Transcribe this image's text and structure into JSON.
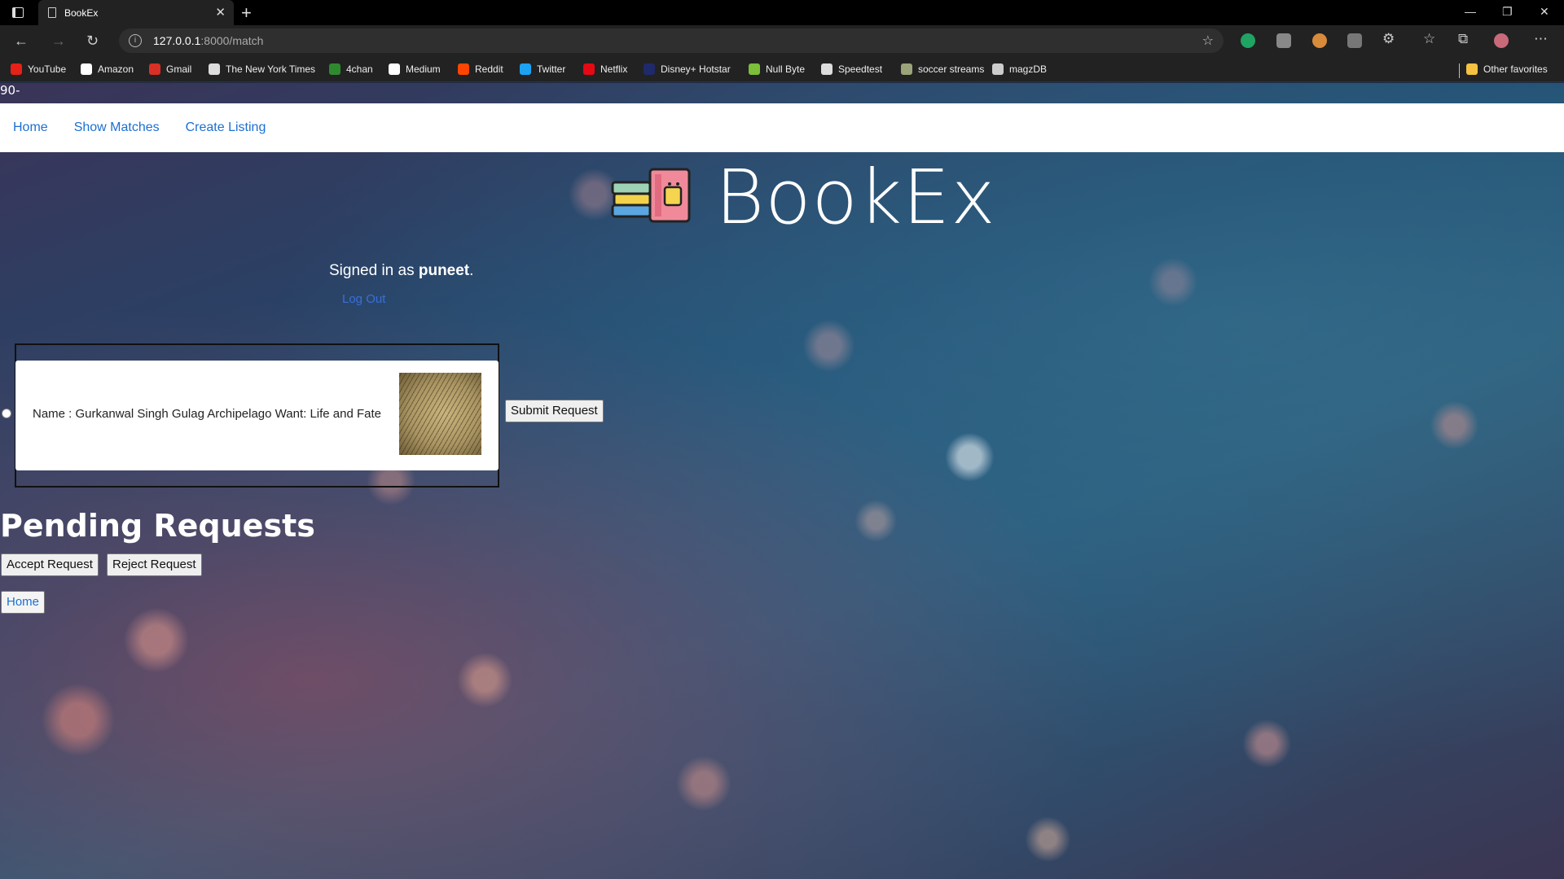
{
  "browser": {
    "tab_title": "BookEx",
    "url_host": "127.0.0.1",
    "url_path": ":8000/match",
    "bookmarks": [
      {
        "label": "YouTube",
        "icon": "youtube-icon",
        "color": "#e62117"
      },
      {
        "label": "Amazon",
        "icon": "amazon-icon",
        "color": "#ffffff"
      },
      {
        "label": "Gmail",
        "icon": "gmail-icon",
        "color": "#d93025"
      },
      {
        "label": "The New York Times",
        "icon": "nyt-icon",
        "color": "#dddddd"
      },
      {
        "label": "4chan",
        "icon": "4chan-icon",
        "color": "#2f8a2f"
      },
      {
        "label": "Medium",
        "icon": "medium-icon",
        "color": "#ffffff"
      },
      {
        "label": "Reddit",
        "icon": "reddit-icon",
        "color": "#ff4500"
      },
      {
        "label": "Twitter",
        "icon": "twitter-icon",
        "color": "#1da1f2"
      },
      {
        "label": "Netflix",
        "icon": "netflix-icon",
        "color": "#e50914"
      },
      {
        "label": "Disney+ Hotstar",
        "icon": "hotstar-icon",
        "color": "#1f2a6b"
      },
      {
        "label": "Null Byte",
        "icon": "nullbyte-icon",
        "color": "#7bbf3a"
      },
      {
        "label": "Speedtest",
        "icon": "speedtest-icon",
        "color": "#dddddd"
      },
      {
        "label": "soccer streams",
        "icon": "soccer-icon",
        "color": "#9ba37a"
      },
      {
        "label": "magzDB",
        "icon": "magzdb-icon",
        "color": "#cccccc"
      }
    ],
    "other_favorites": "Other favorites"
  },
  "page": {
    "stray_text": "90-",
    "nav": [
      "Home",
      "Show Matches",
      "Create Listing"
    ],
    "brand": "BookEx",
    "signed_in_prefix": "Signed in as ",
    "username": "puneet",
    "signed_in_suffix": ".",
    "logout": "Log Out",
    "match_text": "Name : Gurkanwal Singh Gulag Archipelago Want: Life and Fate",
    "submit": "Submit Request",
    "pending_title": "Pending Requests",
    "accept": "Accept Request",
    "reject": "Reject Request",
    "home_button": "Home"
  },
  "colors": {
    "link": "#1d6fd1",
    "chrome_dark": "#222222"
  }
}
